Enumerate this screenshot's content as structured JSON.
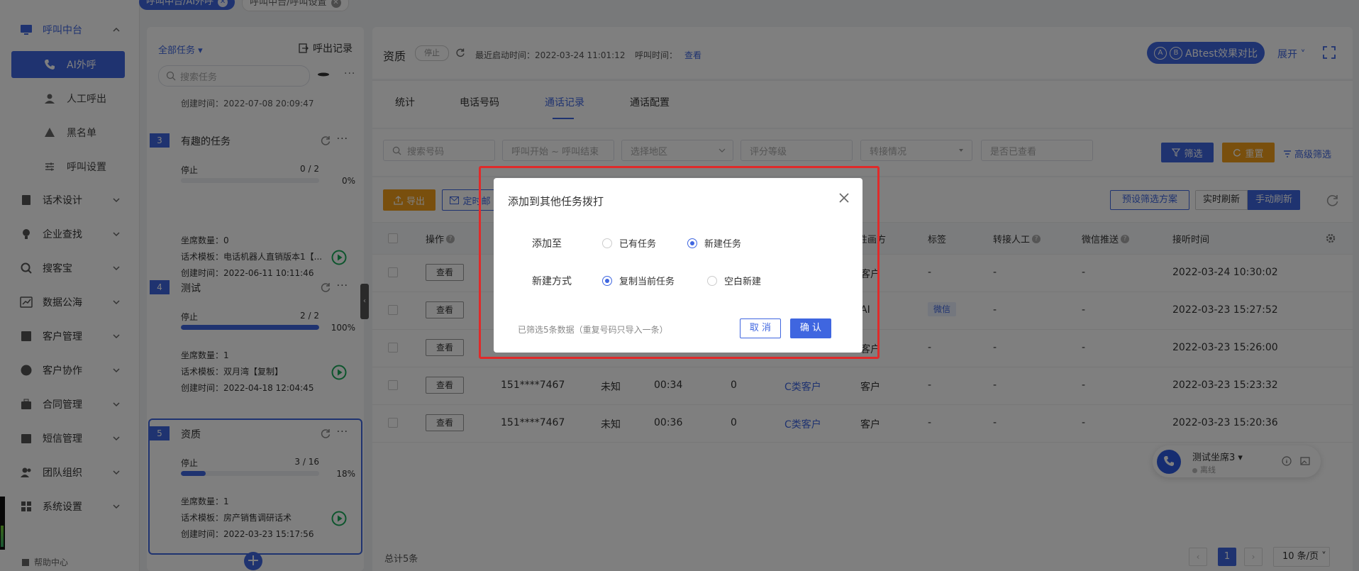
{
  "top_tabs": [
    {
      "label": "呼叫中台/AI外呼",
      "active": true
    },
    {
      "label": "呼叫中台/呼叫设置",
      "active": false
    }
  ],
  "nav": {
    "top": "呼叫中台",
    "sub": [
      "AI外呼",
      "人工呼出",
      "黑名单",
      "呼叫设置"
    ],
    "groups": [
      "话术设计",
      "企业查找",
      "搜客宝",
      "数据公海",
      "客户管理",
      "客户协作",
      "合同管理",
      "短信管理",
      "团队组织",
      "系统设置"
    ],
    "help": "帮助中心"
  },
  "task_panel": {
    "filter": "全部任务",
    "export": "呼出记录",
    "search_placeholder": "搜索任务",
    "partial_top": "创建时间：2022-07-08 20:09:47",
    "tasks": [
      {
        "num": "3",
        "title": "有趣的任务",
        "status": "停止",
        "count": "0 / 2",
        "progress": 0,
        "pct": "0%",
        "seats": "坐席数量：0",
        "template": "话术模板：电话机器人直销版本1【...",
        "created": "创建时间：2022-06-11 10:11:46"
      },
      {
        "num": "4",
        "title": "测试",
        "status": "停止",
        "count": "2 / 2",
        "progress": 100,
        "pct": "100%",
        "seats": "坐席数量：1",
        "template": "话术模板：双月湾【复制】",
        "created": "创建时间：2022-04-18 12:04:45"
      },
      {
        "num": "5",
        "title": "资质",
        "status": "停止",
        "count": "3 / 16",
        "progress": 18,
        "pct": "18%",
        "seats": "坐席数量：1",
        "template": "话术模板：房产销售调研话术",
        "created": "创建时间：2022-03-23 15:17:56"
      }
    ]
  },
  "header": {
    "title": "资质",
    "status": "停止",
    "last_start": "最近启动时间：2022-03-24 11:01:12",
    "call_time_label": "呼叫时间：",
    "call_time_link": "查看",
    "ab_label": "ABtest效果对比",
    "expand": "展开"
  },
  "tabs": [
    "统计",
    "电话号码",
    "通话记录",
    "通话配置"
  ],
  "active_tab": "通话记录",
  "filters": {
    "search_phone": "搜索号码",
    "call_range": "呼叫开始 ~ 呼叫结束",
    "region": "选择地区",
    "rating": "评分等级",
    "transfer": "转接情况",
    "viewed": "是否已查看",
    "filter_btn": "筛选",
    "reset_btn": "重置",
    "advanced": "高级筛选"
  },
  "toolbar": {
    "export": "导出",
    "scheduled": "定时邮",
    "preset": "预设筛选方案",
    "realtime": "实时刷新",
    "manual": "手动刷新"
  },
  "table": {
    "headers": {
      "action": "操作",
      "intent": "性画方",
      "tag": "标签",
      "transfer": "转接人工",
      "wechat": "微信推送",
      "answer_time": "接听时间"
    },
    "view_label": "查看",
    "rows": [
      {
        "phone": "",
        "area": "",
        "duration": "",
        "score": "",
        "level": "",
        "side": "客户",
        "tag": "-",
        "transfer": "-",
        "wechat": "-",
        "time": "2022-03-24 10:30:02"
      },
      {
        "phone": "",
        "area": "",
        "duration": "",
        "score": "",
        "level": "",
        "side": "AI",
        "tag": "微信",
        "transfer": "-",
        "wechat": "-",
        "time": "2022-03-23 15:27:52"
      },
      {
        "phone": "",
        "area": "",
        "duration": "",
        "score": "",
        "level": "",
        "side": "客户",
        "tag": "-",
        "transfer": "-",
        "wechat": "-",
        "time": "2022-03-23 15:26:00"
      },
      {
        "phone": "151****7467",
        "area": "未知",
        "duration": "00:34",
        "score": "0",
        "level": "C类客户",
        "side": "客户",
        "tag": "-",
        "transfer": "-",
        "wechat": "-",
        "time": "2022-03-23 15:23:32"
      },
      {
        "phone": "151****7467",
        "area": "未知",
        "duration": "00:36",
        "score": "0",
        "level": "C类客户",
        "side": "客户",
        "tag": "-",
        "transfer": "-",
        "wechat": "-",
        "time": "2022-03-23 15:20:36"
      }
    ],
    "total": "总计5条",
    "page": "1",
    "page_size": "10 条/页"
  },
  "agent": {
    "name": "测试坐席3",
    "status": "离线"
  },
  "dialog": {
    "title": "添加到其他任务拨打",
    "add_to_label": "添加至",
    "add_to_options": [
      "已有任务",
      "新建任务"
    ],
    "add_to_selected": "新建任务",
    "method_label": "新建方式",
    "method_options": [
      "复制当前任务",
      "空白新建"
    ],
    "method_selected": "复制当前任务",
    "note": "已筛选5条数据（重复号码只导入一条）",
    "cancel": "取 消",
    "confirm": "确 认"
  },
  "colors": {
    "primary": "#3f66e0",
    "warning": "#f29f1a",
    "success": "#1aab5b",
    "highlight": "#e02a2a"
  }
}
